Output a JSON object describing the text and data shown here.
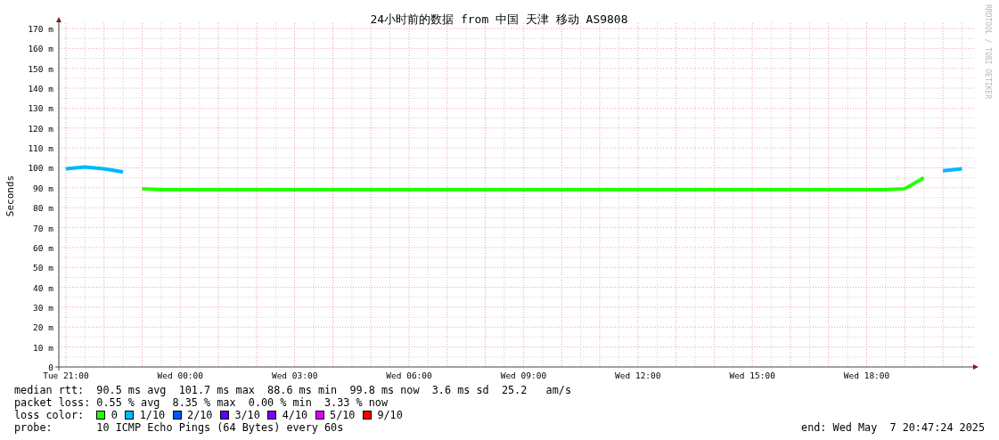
{
  "chart": {
    "credit": "RRDTOOL / TOBI OETIKER",
    "chart_data": {
      "type": "line",
      "title": "24小时前的数据 from 中国 天津 移动 AS9808",
      "ylabel": "Seconds",
      "categories": [
        "Tue 21:00",
        null,
        null,
        null,
        null,
        null,
        "Wed 00:00",
        null,
        null,
        null,
        null,
        null,
        "Wed 03:00",
        null,
        null,
        null,
        null,
        null,
        "Wed 06:00",
        null,
        null,
        null,
        null,
        null,
        "Wed 09:00",
        null,
        null,
        null,
        null,
        null,
        "Wed 12:00",
        null,
        null,
        null,
        null,
        null,
        "Wed 15:00",
        null,
        null,
        null,
        null,
        null,
        "Wed 18:00",
        null,
        null,
        null,
        null,
        null
      ],
      "series": [
        {
          "color": "#00b8ff",
          "values": [
            99.5,
            100.5,
            99.5,
            98,
            null,
            null,
            null,
            null,
            null,
            null,
            null,
            null,
            null,
            null,
            null,
            null,
            null,
            null,
            null,
            null,
            null,
            null,
            null,
            null,
            null,
            null,
            null,
            null,
            null,
            null,
            null,
            null,
            null,
            null,
            null,
            null,
            null,
            null,
            null,
            null,
            null,
            null,
            null,
            null,
            null,
            null,
            98.5,
            99.5
          ]
        },
        {
          "color": "#26ff00",
          "values": [
            null,
            null,
            null,
            null,
            89.5,
            89,
            89,
            89,
            89,
            89,
            89,
            89,
            89,
            89,
            89,
            89,
            89,
            89,
            89,
            89,
            89,
            89,
            89,
            89,
            89,
            89,
            89,
            89,
            89,
            89,
            89,
            89,
            89,
            89,
            89,
            89,
            89,
            89,
            89,
            89,
            89,
            89,
            89,
            89,
            89.5,
            95,
            null,
            null
          ]
        }
      ],
      "grid": true,
      "ylim": [
        0,
        170
      ],
      "yticks": [
        {
          "value": 0,
          "label": "0"
        },
        {
          "value": 10,
          "label": "10 m"
        },
        {
          "value": 20,
          "label": "20 m"
        },
        {
          "value": 30,
          "label": "30 m"
        },
        {
          "value": 40,
          "label": "40 m"
        },
        {
          "value": 50,
          "label": "50 m"
        },
        {
          "value": 60,
          "label": "60 m"
        },
        {
          "value": 70,
          "label": "70 m"
        },
        {
          "value": 80,
          "label": "80 m"
        },
        {
          "value": 90,
          "label": "90 m"
        },
        {
          "value": 100,
          "label": "100 m"
        },
        {
          "value": 110,
          "label": "110 m"
        },
        {
          "value": 120,
          "label": "120 m"
        },
        {
          "value": 130,
          "label": "130 m"
        },
        {
          "value": 140,
          "label": "140 m"
        },
        {
          "value": 150,
          "label": "150 m"
        },
        {
          "value": 160,
          "label": "160 m"
        },
        {
          "value": 170,
          "label": "170 m"
        }
      ]
    }
  },
  "stats": [
    {
      "label": "median rtt:",
      "value": "90.5 ms avg  101.7 ms max  88.6 ms min  99.8 ms now  3.6 ms sd  25.2   am/s"
    },
    {
      "label": "packet loss:",
      "value": "0.55 % avg  8.35 % max  0.00 % min  3.33 % now"
    }
  ],
  "loss_color": {
    "label": "loss color:",
    "items": [
      {
        "label": "0",
        "color": "#26ff00"
      },
      {
        "label": "1/10",
        "color": "#00b8ff"
      },
      {
        "label": "2/10",
        "color": "#0059ff"
      },
      {
        "label": "3/10",
        "color": "#5e00ff"
      },
      {
        "label": "4/10",
        "color": "#7e00ff"
      },
      {
        "label": "5/10",
        "color": "#dd00ff"
      },
      {
        "label": "9/10",
        "color": "#ff0000"
      }
    ]
  },
  "probe": {
    "label": "probe:",
    "value": "10 ICMP Echo Pings (64 Bytes) every 60s"
  },
  "end": "end: Wed May  7 20:47:24 2025"
}
